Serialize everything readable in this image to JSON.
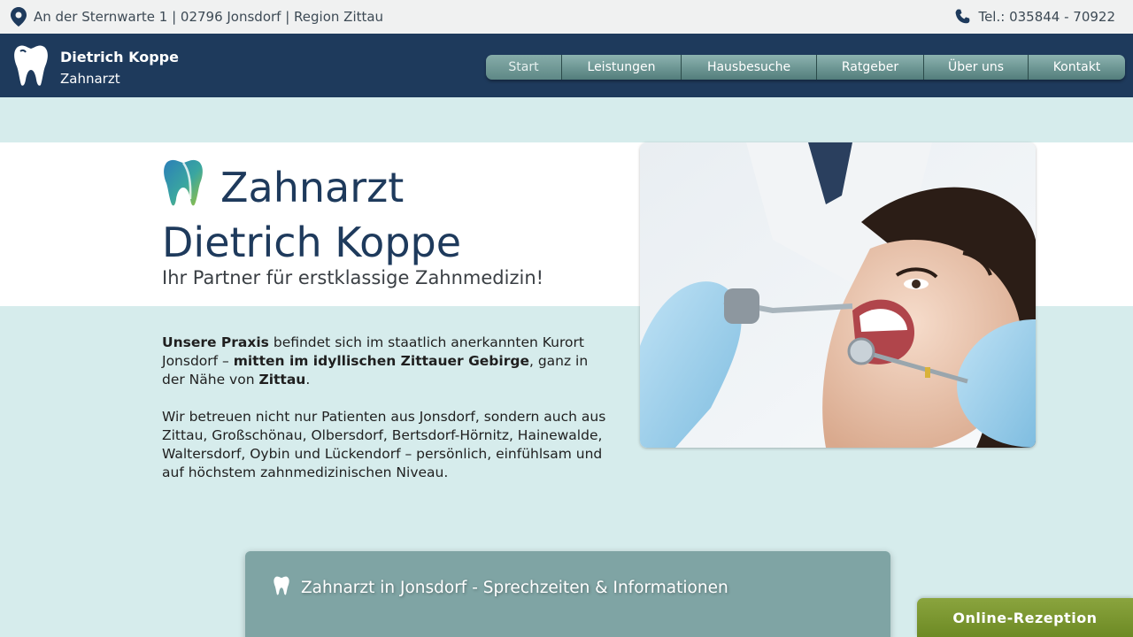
{
  "topbar": {
    "address": "An der Sternwarte 1 | 02796 Jonsdorf | Region Zittau",
    "phone": "Tel.: 035844 - 70922"
  },
  "header": {
    "name": "Dietrich Koppe",
    "subtitle": "Zahnarzt"
  },
  "nav": {
    "items": [
      {
        "label": "Start"
      },
      {
        "label": "Leistungen"
      },
      {
        "label": "Hausbesuche"
      },
      {
        "label": "Ratgeber"
      },
      {
        "label": "Über uns"
      },
      {
        "label": "Kontakt"
      }
    ]
  },
  "hero": {
    "title_line1": "Zahnarzt",
    "title_line2": "Dietrich Koppe",
    "tagline": "Ihr Partner für erstklassige Zahnmedizin!"
  },
  "intro": {
    "p1_b1": "Unsere Praxis",
    "p1_t1": " befindet sich im staatlich anerkannten Kurort Jonsdorf – ",
    "p1_b2": "mitten im idyllischen Zittauer Gebirge",
    "p1_t2": ", ganz in der Nähe von ",
    "p1_b3": "Zittau",
    "p1_t3": ".",
    "p2": "Wir betreuen nicht nur Patienten aus Jonsdorf, sondern auch aus Zittau, Großschönau, Olbersdorf,  Bertsdorf-Hörnitz, Hainewalde, Waltersdorf, Oybin und Lückendorf – persönlich, einfühlsam und auf höchstem zahnmedizinischen Niveau."
  },
  "info": {
    "heading": "Zahnarzt in Jonsdorf - Sprechzeiten & Informationen"
  },
  "rezeption": {
    "label": "Online-Rezeption"
  },
  "colors": {
    "header_bg": "#1e3a5c",
    "nav_teal": "#6f9896",
    "background": "#d6ecec",
    "panel": "#7fa4a4",
    "button_green": "#7c9a30"
  }
}
